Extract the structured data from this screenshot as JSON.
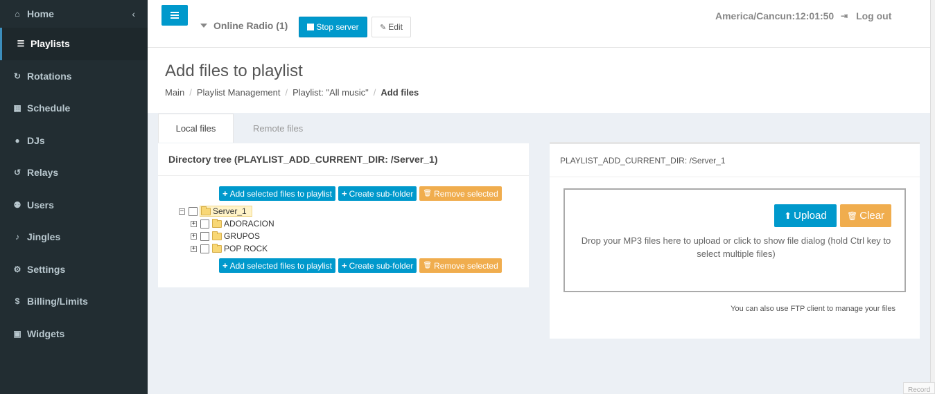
{
  "sidebar": {
    "items": [
      {
        "label": "Home",
        "icon": "home-icon"
      },
      {
        "label": "Playlists",
        "icon": "list-icon"
      },
      {
        "label": "Rotations",
        "icon": "refresh-icon"
      },
      {
        "label": "Schedule",
        "icon": "calendar-icon"
      },
      {
        "label": "DJs",
        "icon": "user-icon"
      },
      {
        "label": "Relays",
        "icon": "repeat-icon"
      },
      {
        "label": "Users",
        "icon": "users-icon"
      },
      {
        "label": "Jingles",
        "icon": "bell-icon"
      },
      {
        "label": "Settings",
        "icon": "gears-icon"
      },
      {
        "label": "Billing/Limits",
        "icon": "dollar-icon"
      },
      {
        "label": "Widgets",
        "icon": "gift-icon"
      }
    ],
    "collapse_glyph": "‹"
  },
  "header": {
    "server_name": "Online Radio (1)",
    "stop_label": "Stop server",
    "edit_label": "Edit",
    "timezone_time": "America/Cancun:12:01:50",
    "logout_label": "Log out"
  },
  "page": {
    "title": "Add files to playlist",
    "breadcrumb": {
      "main": "Main",
      "playlist_mgmt": "Playlist Management",
      "playlist": "Playlist: \"All music\"",
      "current": "Add files"
    }
  },
  "tabs": {
    "local": "Local files",
    "remote": "Remote files"
  },
  "left_panel": {
    "title": "Directory tree (PLAYLIST_ADD_CURRENT_DIR: /Server_1)",
    "add_label": "Add selected files to playlist",
    "create_label": "Create sub-folder",
    "remove_label": "Remove selected",
    "tree": {
      "root": "Server_1",
      "children": [
        "ADORACION",
        "GRUPOS",
        "POP ROCK"
      ]
    }
  },
  "right_panel": {
    "title": "PLAYLIST_ADD_CURRENT_DIR: /Server_1",
    "upload_label": "Upload",
    "clear_label": "Clear",
    "drop_text": "Drop your MP3 files here to upload or click to show file dialog (hold Ctrl key to select multiple files)",
    "ftp_note": "You can also use FTP client to manage your files"
  },
  "corner_tag": "Record",
  "colors": {
    "sidebar_bg": "#222d32",
    "primary": "#0099cc",
    "warning": "#f0ad4e"
  }
}
